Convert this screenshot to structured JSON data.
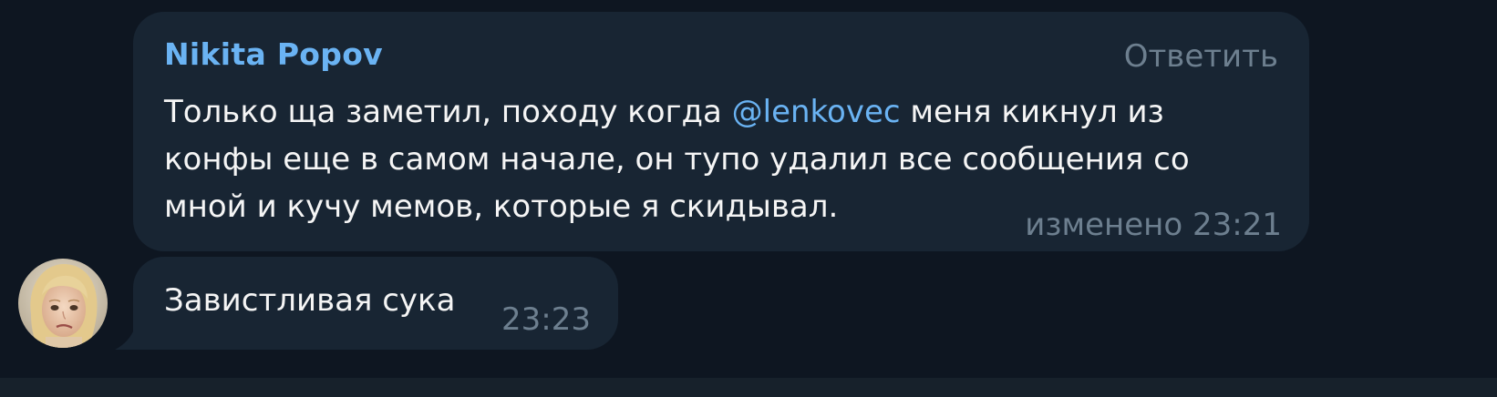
{
  "message1": {
    "sender": "Nikita Popov",
    "reply_label": "Ответить",
    "text_part1": "Только ща заметил, походу когда ",
    "mention": "@lenkovec",
    "text_part2": " меня кикнул из",
    "text_line2": "конфы еще в самом начале, он тупо удалил все сообщения со",
    "text_line3": "мной и кучу мемов, которые я скидывал.",
    "edited_label": "изменено",
    "time": "23:21"
  },
  "message2": {
    "text": "Завистливая сука",
    "time": "23:23"
  },
  "avatar": {
    "icon": "user-avatar-photo"
  },
  "colors": {
    "background": "#0e1621",
    "bubble": "#182533",
    "sender": "#6ab3f3",
    "mention": "#6ab3f3",
    "text": "#f5f5f5",
    "meta": "#6d7f8f"
  }
}
